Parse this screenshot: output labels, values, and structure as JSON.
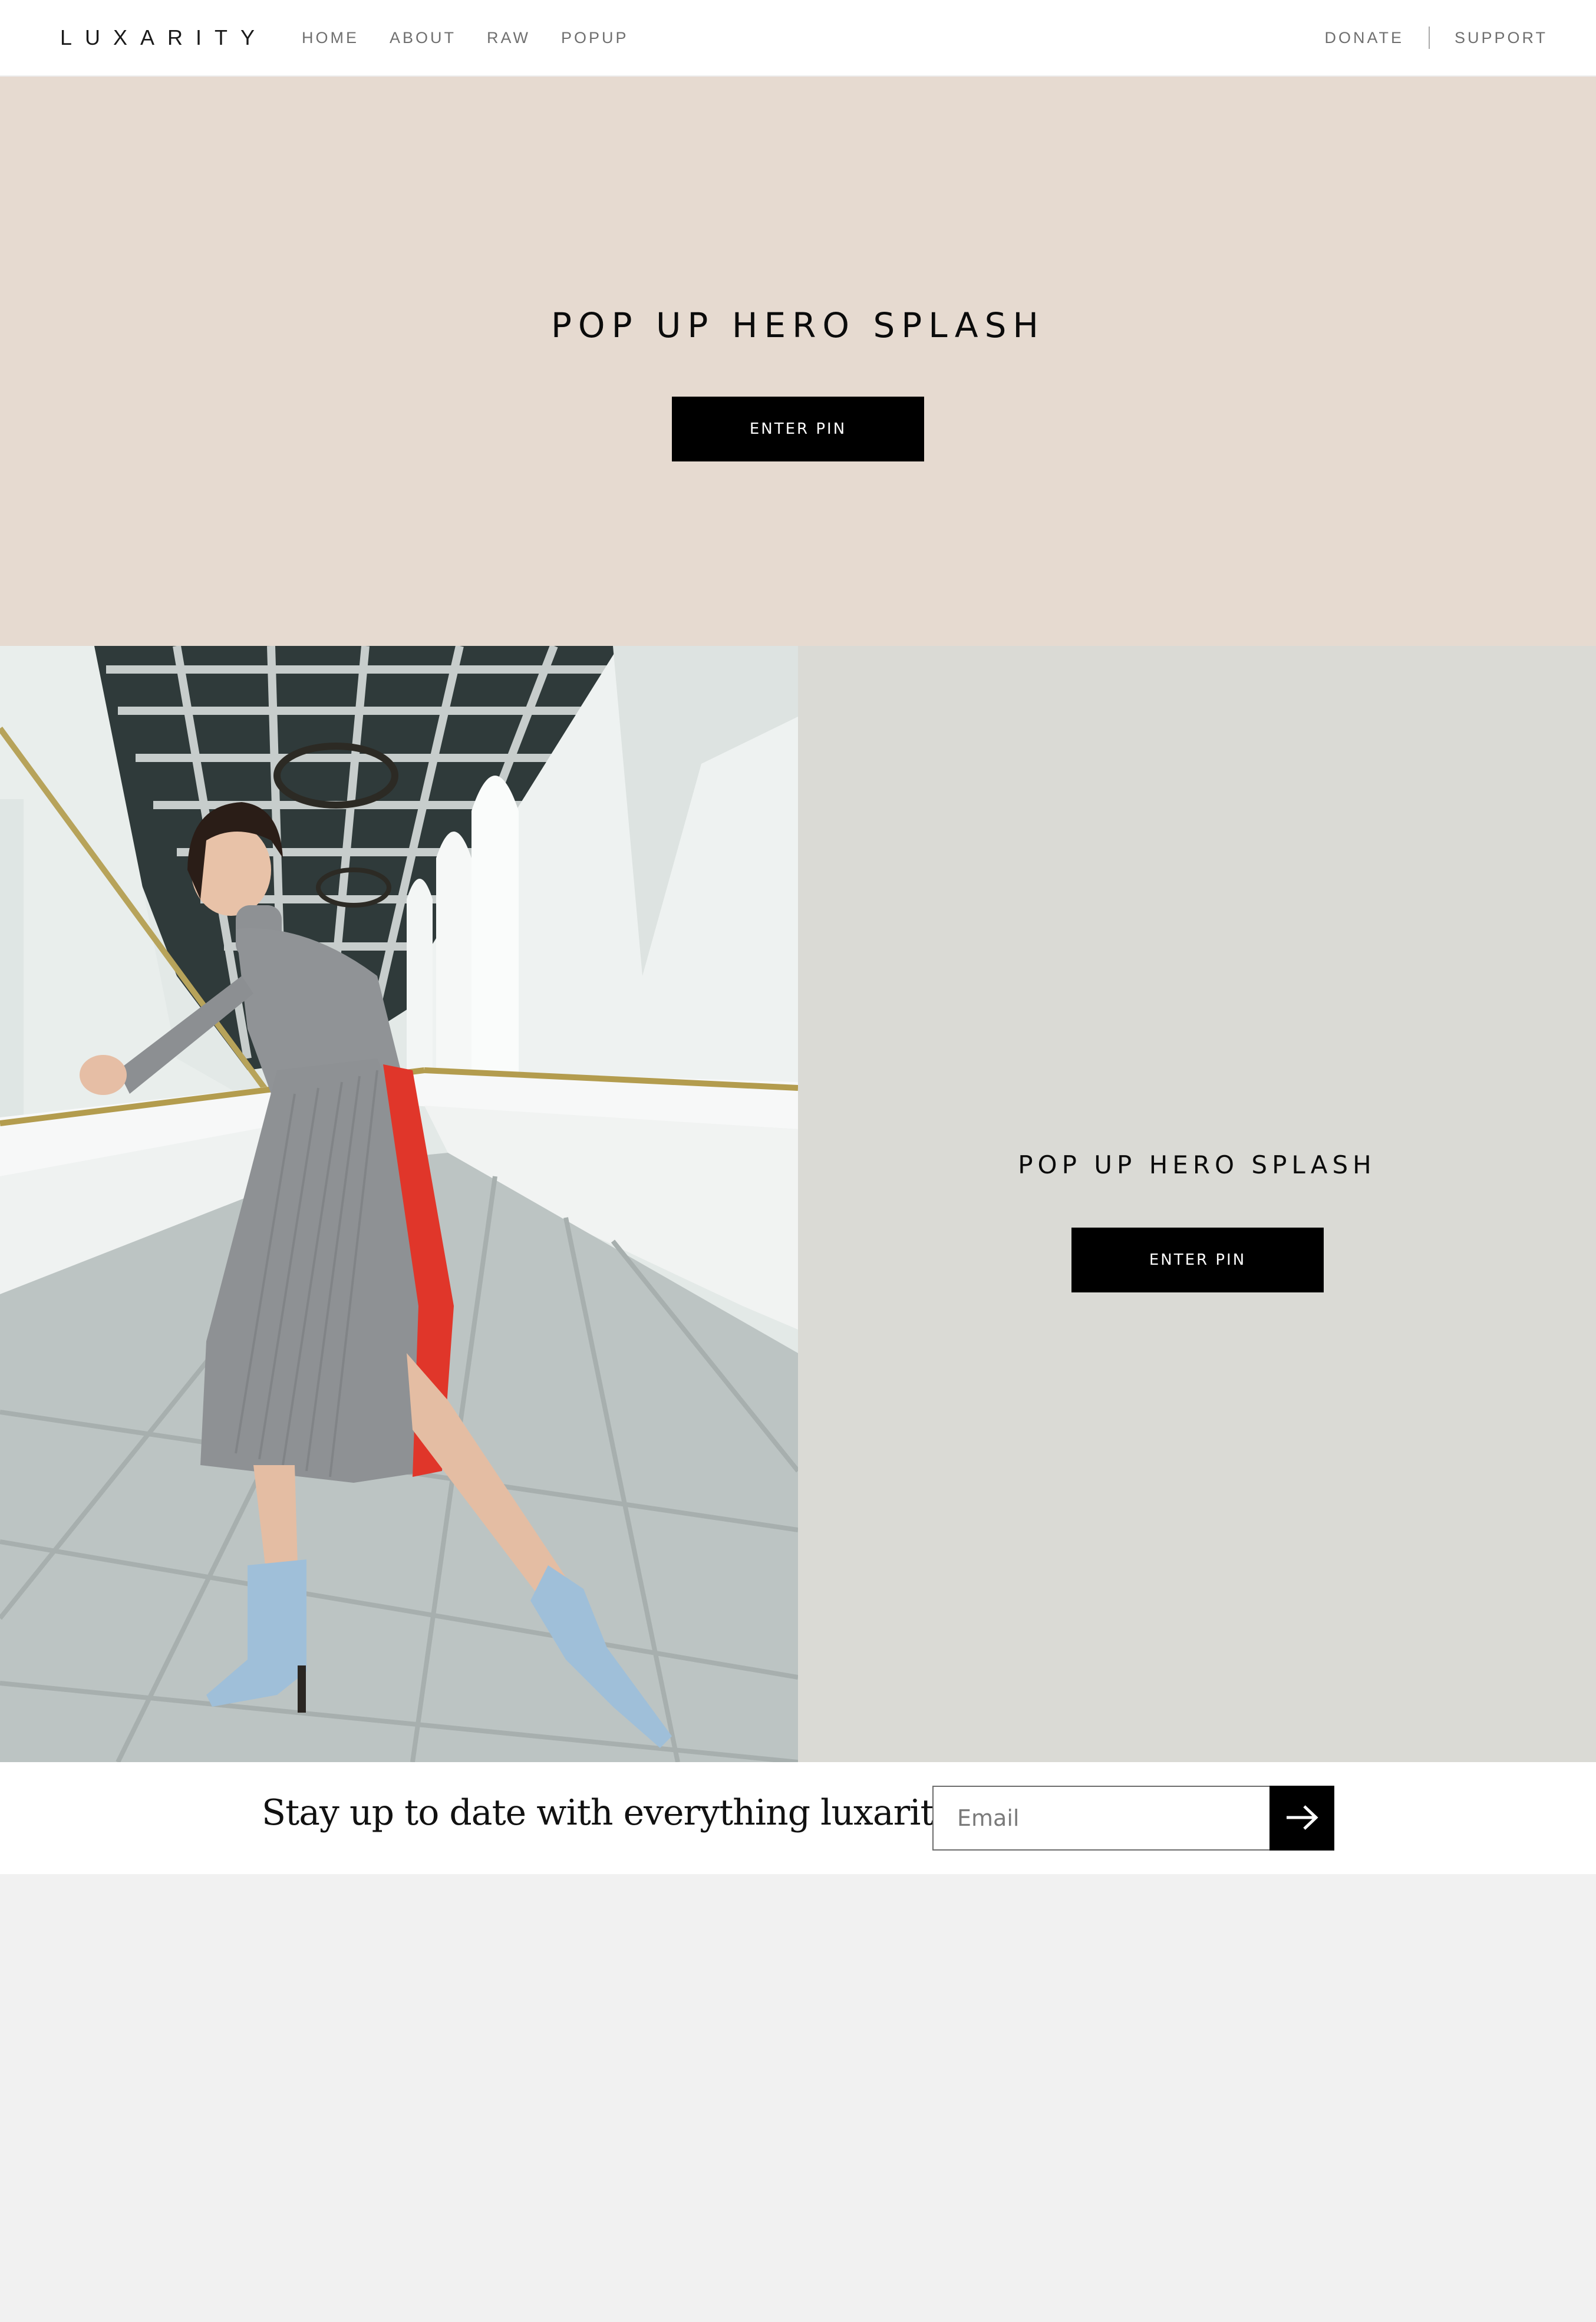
{
  "header": {
    "logo": "LUXARITY",
    "nav_left": [
      {
        "label": "HOME"
      },
      {
        "label": "ABOUT"
      },
      {
        "label": "RAW"
      },
      {
        "label": "POPUP"
      }
    ],
    "nav_right": [
      {
        "label": "DONATE"
      },
      {
        "label": "SUPPORT"
      }
    ]
  },
  "hero_top": {
    "title": "POP UP HERO SPLASH",
    "button_label": "ENTER PIN",
    "background": "#e6dad0"
  },
  "hero_split": {
    "title": "POP UP HERO SPLASH",
    "button_label": "ENTER PIN",
    "background": "#dadad5",
    "photo": "fashion-model-photo"
  },
  "newsletter": {
    "text": "Stay up to date with everything luxarity",
    "email_placeholder": "Email",
    "submit_icon": "arrow-right-icon"
  },
  "colors": {
    "button": "#000000",
    "button_text": "#ffffff",
    "nav_text": "#6f6f6f",
    "page_background": "#f1f1f1"
  }
}
